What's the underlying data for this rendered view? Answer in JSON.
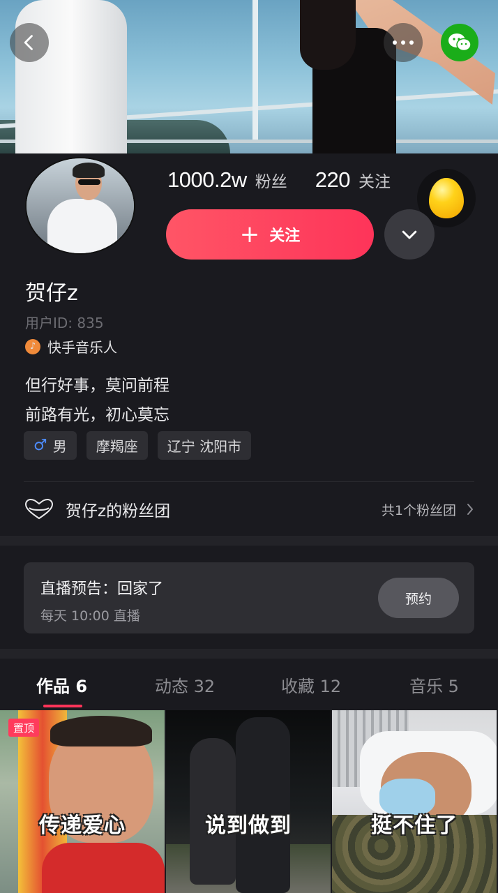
{
  "header": {
    "icons": {
      "back": "chevron-left-icon",
      "more": "more-dots-icon",
      "wechat": "wechat-icon"
    }
  },
  "stats": {
    "fans_count": "1000.2w",
    "fans_label": "粉丝",
    "following_count": "220",
    "following_label": "关注"
  },
  "actions": {
    "follow_label": "关注",
    "accent_color": "#fe3459"
  },
  "profile": {
    "name": "贺仔z",
    "user_id": "用户ID: 835",
    "badge": "快手音乐人",
    "bio_line1": "但行好事，莫问前程",
    "bio_line2": "前路有光，初心莫忘",
    "tags": [
      "男",
      "摩羯座",
      "辽宁 沈阳市"
    ]
  },
  "fan_club": {
    "label": "贺仔z的粉丝团",
    "count_text": "共1个粉丝团"
  },
  "live_notice": {
    "title": "直播预告：回家了",
    "schedule": "每天 10:00 直播",
    "reserve_label": "预约"
  },
  "tabs": [
    {
      "label": "作品 6",
      "active": true
    },
    {
      "label": "动态 32",
      "active": false
    },
    {
      "label": "收藏 12",
      "active": false
    },
    {
      "label": "音乐 5",
      "active": false
    }
  ],
  "videos": [
    {
      "caption": "传递爱心",
      "pinned_label": "置顶"
    },
    {
      "caption": "说到做到"
    },
    {
      "caption": "挺不住了"
    }
  ]
}
